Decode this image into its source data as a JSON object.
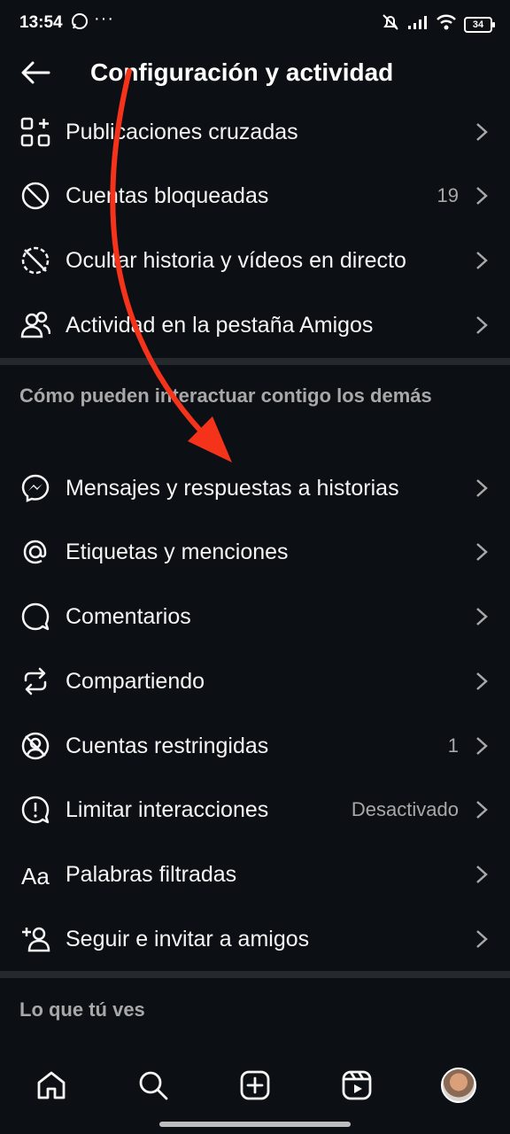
{
  "status_bar": {
    "time": "13:54",
    "more": "···",
    "battery": "34"
  },
  "header": {
    "title": "Configuración y actividad"
  },
  "items_top": [
    {
      "label": "Publicaciones cruzadas",
      "icon": "grid-plus-icon"
    },
    {
      "label": "Cuentas bloqueadas",
      "value": "19",
      "icon": "blocked-icon"
    },
    {
      "label": "Ocultar historia y vídeos en directo",
      "icon": "hide-story-icon"
    },
    {
      "label": "Actividad en la pestaña Amigos",
      "icon": "people-icon"
    }
  ],
  "section_interact": {
    "title": "Cómo pueden interactuar contigo los demás"
  },
  "items_interact": [
    {
      "label": "Mensajes y respuestas a historias",
      "icon": "messenger-icon"
    },
    {
      "label": "Etiquetas y menciones",
      "icon": "at-icon"
    },
    {
      "label": "Comentarios",
      "icon": "comment-icon"
    },
    {
      "label": "Compartiendo",
      "icon": "share-repost-icon"
    },
    {
      "label": "Cuentas restringidas",
      "value": "1",
      "icon": "restricted-icon"
    },
    {
      "label": "Limitar interacciones",
      "value": "Desactivado",
      "icon": "limit-icon"
    },
    {
      "label": "Palabras filtradas",
      "icon": "text-aa-icon"
    },
    {
      "label": "Seguir e invitar a amigos",
      "icon": "add-person-icon"
    }
  ],
  "section_view": {
    "title": "Lo que tú ves"
  },
  "bottom_nav": [
    "home-icon",
    "search-icon",
    "create-icon",
    "reels-icon",
    "profile-avatar"
  ],
  "colors": {
    "background": "#0c1014",
    "text": "#f5f5f5",
    "secondary": "#a8a8a8",
    "annotation_arrow": "#f5331b"
  }
}
